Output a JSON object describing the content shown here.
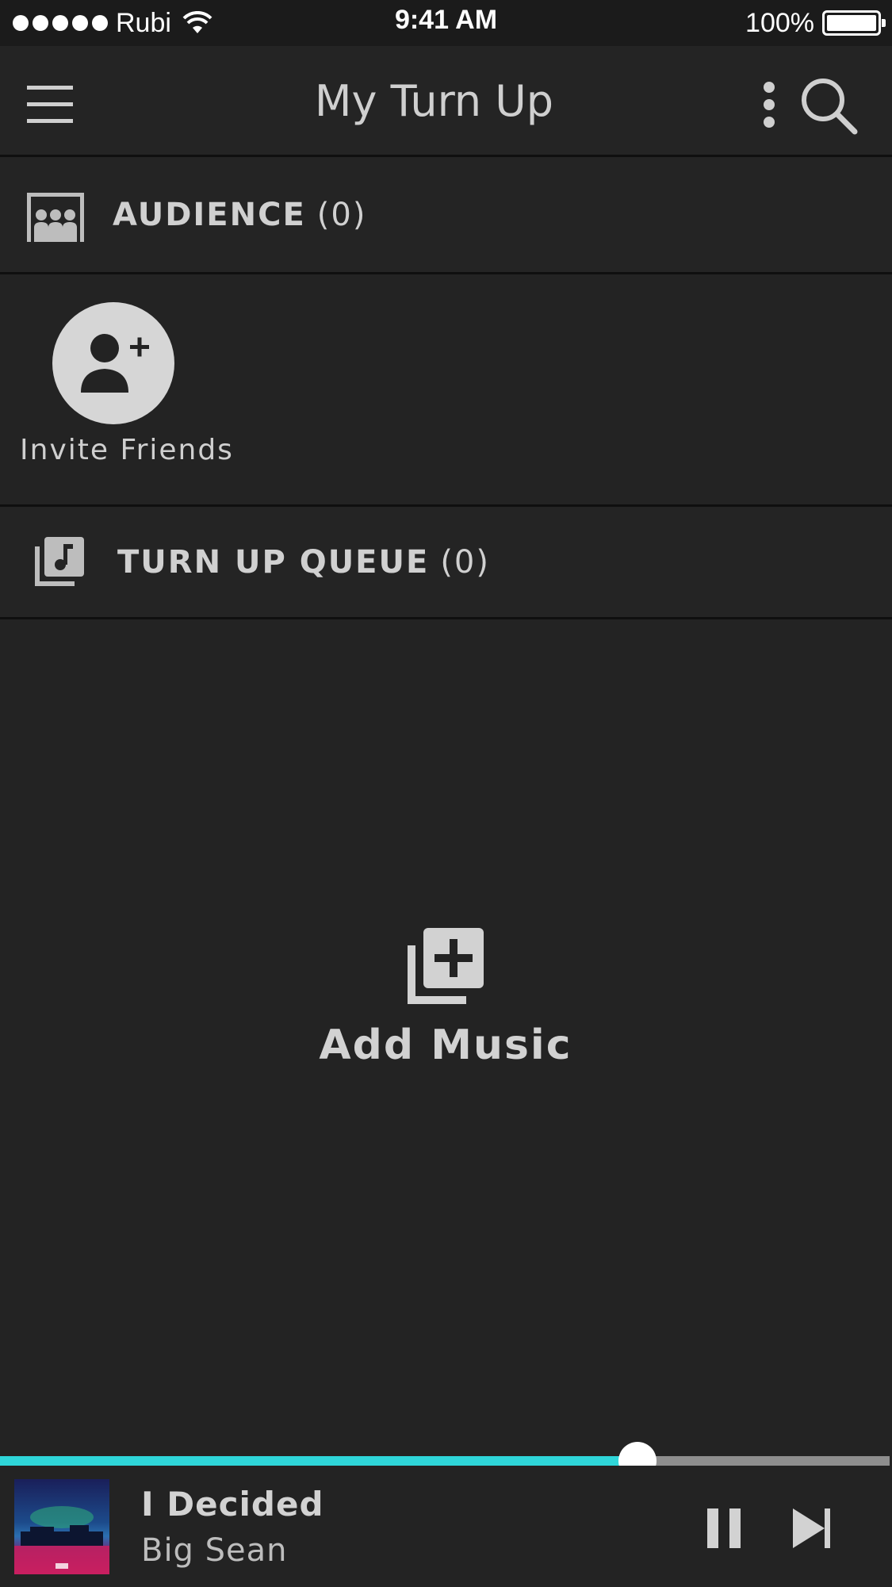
{
  "status_bar": {
    "carrier": "Rubi",
    "time": "9:41 AM",
    "battery": "100%"
  },
  "nav": {
    "title": "My Turn Up",
    "icons": [
      "menu-icon",
      "more-vertical-icon",
      "search-icon"
    ]
  },
  "audience": {
    "label": "AUDIENCE",
    "count": "(0)",
    "icon": "audience-icon"
  },
  "invite": {
    "label": "Invite Friends",
    "icon": "add-person-icon"
  },
  "queue": {
    "label": "TURN UP QUEUE",
    "count": "(0)",
    "icon": "music-library-icon"
  },
  "add_music": {
    "label": "Add Music",
    "icon": "add-to-library-icon"
  },
  "player": {
    "title": "I Decided",
    "artist": "Big Sean",
    "progress": 0.717,
    "accent_color": "#2fd6d9",
    "icons": [
      "pause-icon",
      "skip-next-icon"
    ]
  }
}
